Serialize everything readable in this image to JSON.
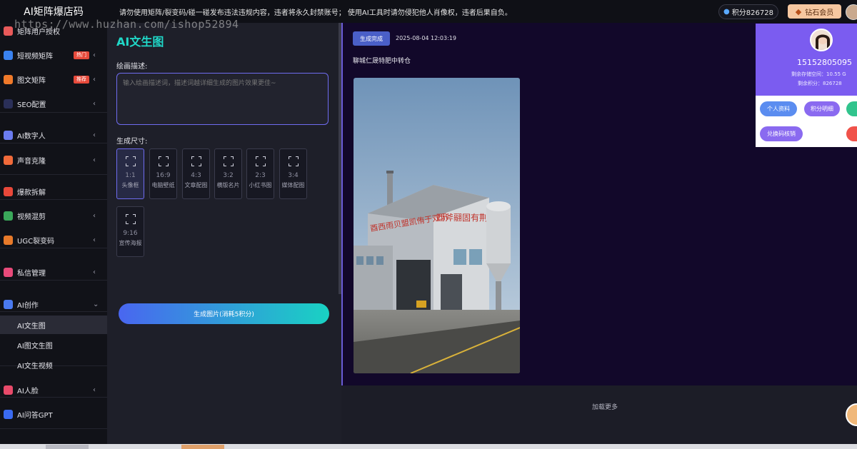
{
  "app": {
    "title": "AI矩阵爆店码"
  },
  "notice": "请勿使用矩阵/裂变码/碰一碰发布违法违规内容，违者将永久封禁账号； 使用AI工具时请勿侵犯他人肖像权，违者后果自负。",
  "header": {
    "points_label": "积分826728",
    "vip_label": "钻石会员"
  },
  "watermark": "https://www.huzhan.com/ishop52894",
  "sidebar": {
    "items": [
      {
        "label": "矩阵用户授权",
        "icon": "users-icon",
        "color": "#e85a5a"
      },
      {
        "label": "短视频矩阵",
        "icon": "video-matrix-icon",
        "color": "#3a82f0",
        "badge": "热门"
      },
      {
        "label": "图文矩阵",
        "icon": "image-text-icon",
        "color": "#f07a2a",
        "badge": "推荐"
      },
      {
        "label": "SEO配置",
        "icon": "seo-icon",
        "color": "#2a2f58"
      },
      {
        "label": "AI数字人",
        "icon": "digital-human-icon",
        "color": "#6b7cf0"
      },
      {
        "label": "声音克隆",
        "icon": "voice-clone-icon",
        "color": "#f06a3a"
      },
      {
        "label": "爆款拆解",
        "icon": "fire-icon",
        "color": "#e8483a"
      },
      {
        "label": "视频混剪",
        "icon": "video-edit-icon",
        "color": "#3aa85a"
      },
      {
        "label": "UGC裂变码",
        "icon": "qrcode-icon",
        "color": "#e87a2a"
      },
      {
        "label": "私信管理",
        "icon": "message-icon",
        "color": "#e84a7a"
      },
      {
        "label": "AI创作",
        "icon": "ai-create-icon",
        "color": "#4a7af0"
      },
      {
        "label": "AI人脸",
        "icon": "face-icon",
        "color": "#e84a6a"
      },
      {
        "label": "AI问答GPT",
        "icon": "gpt-icon",
        "color": "#3a6af0"
      }
    ],
    "sub_items": [
      "AI文生图",
      "AI图文生图",
      "AI文生视频"
    ]
  },
  "panel": {
    "title": "AI文生图",
    "prompt_label": "绘画描述:",
    "prompt_placeholder": "输入绘画描述词，描述词越详细生成的图片效果更佳~",
    "size_label": "生成尺寸:",
    "sizes": [
      {
        "ratio": "1:1",
        "name": "头像框"
      },
      {
        "ratio": "16:9",
        "name": "电脑壁纸"
      },
      {
        "ratio": "4:3",
        "name": "文章配图"
      },
      {
        "ratio": "3:2",
        "name": "横版名片"
      },
      {
        "ratio": "2:3",
        "name": "小红书图"
      },
      {
        "ratio": "3:4",
        "name": "媒体配图"
      },
      {
        "ratio": "9:16",
        "name": "宣传海报"
      }
    ],
    "generate_label": "生成图片(消耗5积分)"
  },
  "result": {
    "status": "生成完成",
    "time": "2025-08-04 12:03:19",
    "prompt": "聊城仁晟特肥中转仓",
    "building_sign_left": "酉西雨贝盟凯侑于双汛",
    "building_sign_right": "酉斧翮固有荆",
    "load_more": "加载更多"
  },
  "user_card": {
    "phone": "15152805095",
    "storage": "剩余存储空间：10.55 G",
    "points": "剩余积分：826728",
    "buttons": [
      "个人资料",
      "积分明细",
      "兑换码核销"
    ]
  }
}
